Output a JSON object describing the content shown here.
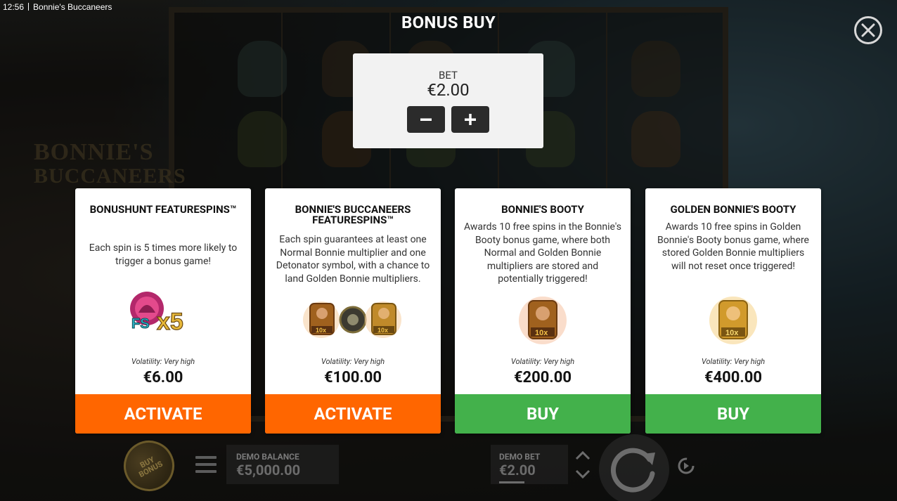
{
  "status_bar": {
    "time": "12:56",
    "app_title": "Bonnie's Buccaneers"
  },
  "background_logo": {
    "line1": "BONNIE'S",
    "line2": "BUCCANEERS"
  },
  "header": {
    "title": "BONUS BUY"
  },
  "bet": {
    "label": "BET",
    "value": "€2.00"
  },
  "cards": [
    {
      "title": "BONUSHUNT FEATURESPINS™",
      "description": "Each spin is 5 times more likely to trigger a bonus game!",
      "art_text": "FS x5",
      "volatility": "Volatility: Very high",
      "price": "€6.00",
      "action": "ACTIVATE",
      "action_color": "#ff6600"
    },
    {
      "title": "BONNIE'S BUCCANEERS FEATURESPINS™",
      "description": "Each spin guarantees at least one Normal Bonnie multiplier and one Detonator symbol, with a chance to land Golden Bonnie multipliers.",
      "art_badges": [
        "10x",
        "10x"
      ],
      "volatility": "Volatility: Very high",
      "price": "€100.00",
      "action": "ACTIVATE",
      "action_color": "#ff6600"
    },
    {
      "title": "BONNIE'S BOOTY",
      "description": "Awards 10 free spins in the Bonnie's Booty bonus game, where both Normal and Golden Bonnie multipliers are stored and potentially triggered!",
      "art_badges": [
        "10x"
      ],
      "volatility": "Volatility: Very high",
      "price": "€200.00",
      "action": "BUY",
      "action_color": "#43b14b"
    },
    {
      "title": "GOLDEN BONNIE'S BOOTY",
      "description": "Awards 10 free spins in Golden Bonnie's Booty bonus game, where stored Golden Bonnie multipliers will not reset once triggered!",
      "art_badges": [
        "10x"
      ],
      "volatility": "Volatility: Very high",
      "price": "€400.00",
      "action": "BUY",
      "action_color": "#43b14b"
    }
  ],
  "bottom_bar": {
    "buy_bonus_label": "BUY BONUS",
    "demo_balance_label": "DEMO BALANCE",
    "demo_balance_value": "€5,000.00",
    "demo_bet_label": "DEMO BET",
    "demo_bet_value": "€2.00"
  },
  "icons": {
    "close": "close-icon",
    "minus": "minus-icon",
    "plus": "plus-icon",
    "menu": "menu-icon",
    "spin": "spin-icon",
    "autoplay": "autoplay-icon",
    "arrow_up": "chevron-up-icon",
    "arrow_down": "chevron-down-icon"
  }
}
